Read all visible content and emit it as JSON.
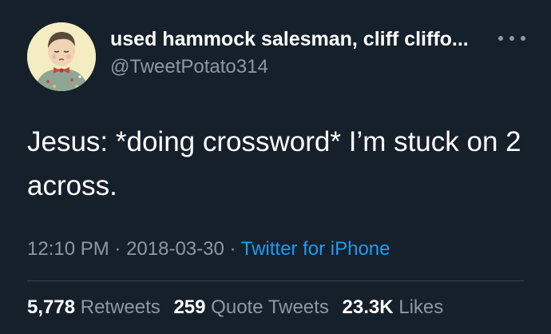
{
  "author": {
    "display_name": "used hammock salesman, cliff cliffo...",
    "handle": "@TweetPotato314"
  },
  "tweet": {
    "text": "Jesus: *doing crossword* I’m stuck on 2 across."
  },
  "meta": {
    "time": "12:10 PM",
    "date": "2018-03-30",
    "separator": " · ",
    "source": "Twitter for iPhone"
  },
  "stats": {
    "retweets_count": "5,778",
    "retweets_label": "Retweets",
    "quotes_count": "259",
    "quotes_label": "Quote Tweets",
    "likes_count": "23.3K",
    "likes_label": "Likes"
  },
  "icons": {
    "more": "more-horizontal-icon"
  },
  "colors": {
    "background": "#15202b",
    "text_primary": "#ffffff",
    "text_secondary": "#8b98a5",
    "link": "#1d9bf0",
    "divider": "#38444d"
  }
}
